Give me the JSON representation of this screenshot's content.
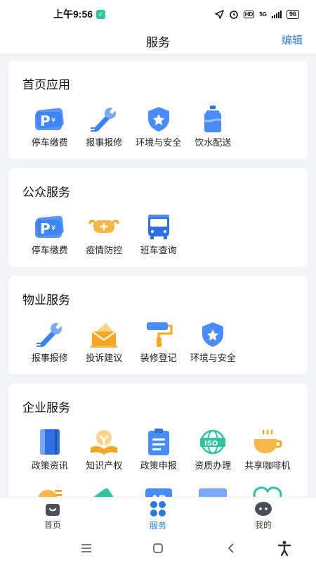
{
  "status_bar": {
    "time": "上午9:56",
    "net": "5G",
    "battery": "96"
  },
  "header": {
    "title": "服务",
    "edit_label": "编辑"
  },
  "sections": [
    {
      "title": "首页应用",
      "items": [
        {
          "label": "停车缴费",
          "icon": "parking-icon"
        },
        {
          "label": "报事报修",
          "icon": "wrench-icon"
        },
        {
          "label": "环境与安全",
          "icon": "shield-star-icon"
        },
        {
          "label": "饮水配送",
          "icon": "water-jug-icon"
        }
      ]
    },
    {
      "title": "公众服务",
      "items": [
        {
          "label": "停车缴费",
          "icon": "parking-icon"
        },
        {
          "label": "疫情防控",
          "icon": "mask-icon"
        },
        {
          "label": "班车查询",
          "icon": "bus-icon"
        }
      ]
    },
    {
      "title": "物业服务",
      "items": [
        {
          "label": "报事报修",
          "icon": "wrench-icon"
        },
        {
          "label": "投诉建议",
          "icon": "envelope-icon"
        },
        {
          "label": "装修登记",
          "icon": "paint-roller-icon"
        },
        {
          "label": "环境与安全",
          "icon": "shield-star-icon"
        }
      ]
    },
    {
      "title": "企业服务",
      "items": [
        {
          "label": "政策资讯",
          "icon": "book-icon"
        },
        {
          "label": "知识产权",
          "icon": "lightbulb-book-icon"
        },
        {
          "label": "政策申报",
          "icon": "clipboard-icon"
        },
        {
          "label": "资质办理",
          "icon": "iso-globe-icon"
        },
        {
          "label": "共享咖啡机",
          "icon": "coffee-cup-icon"
        }
      ]
    }
  ],
  "tabbar": [
    {
      "label": "首页",
      "icon": "home-icon",
      "active": false
    },
    {
      "label": "服务",
      "icon": "grid-icon",
      "active": true
    },
    {
      "label": "我的",
      "icon": "chat-face-icon",
      "active": false
    }
  ],
  "colors": {
    "accent": "#2e7bd6",
    "icon_blue": "#3b82f6",
    "icon_orange": "#f5a623"
  }
}
